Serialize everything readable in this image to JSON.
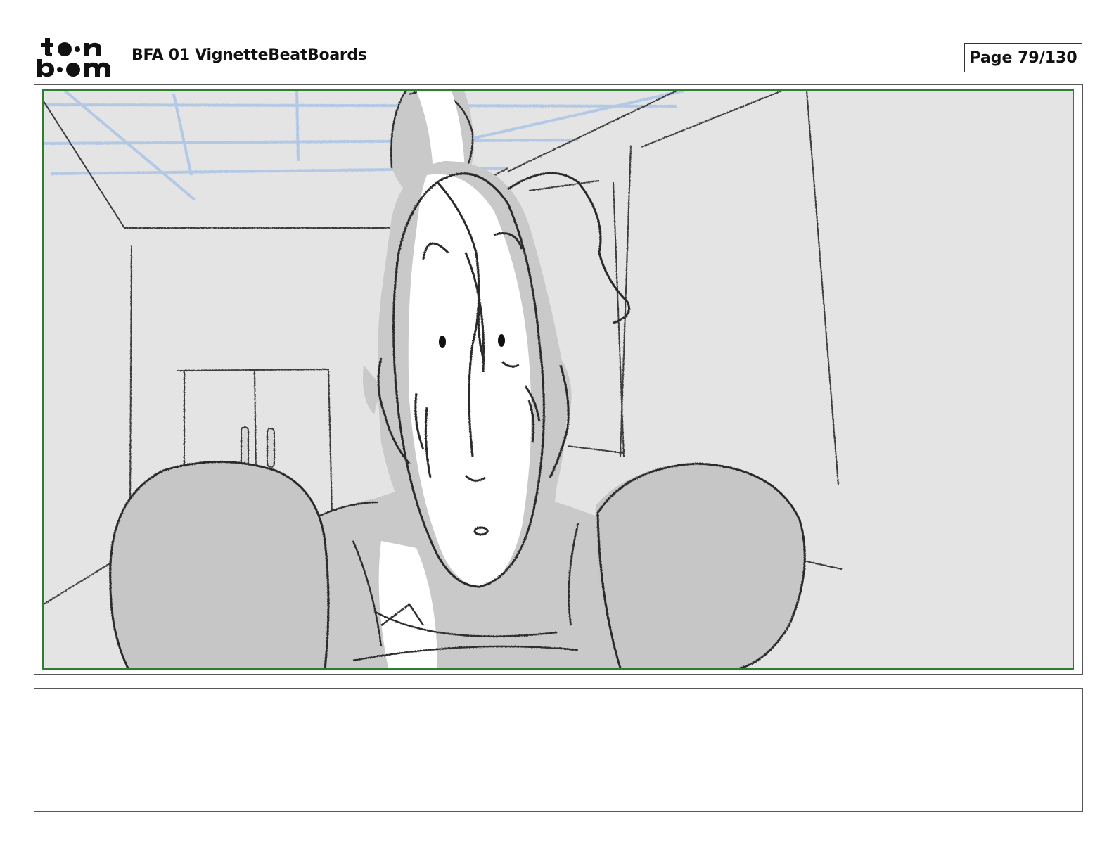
{
  "header": {
    "logo_text": "toon boom",
    "document_title": "BFA 01 VignetteBeatBoards",
    "page_label": "Page",
    "page_number": "79/130"
  },
  "panel": {
    "frame_color": "#2e7d32",
    "background_color": "#e3e3e3",
    "sketch_line_color": "#2a2a2a",
    "ceiling_line_color": "#9bbbe0"
  },
  "notes": {
    "text": ""
  }
}
